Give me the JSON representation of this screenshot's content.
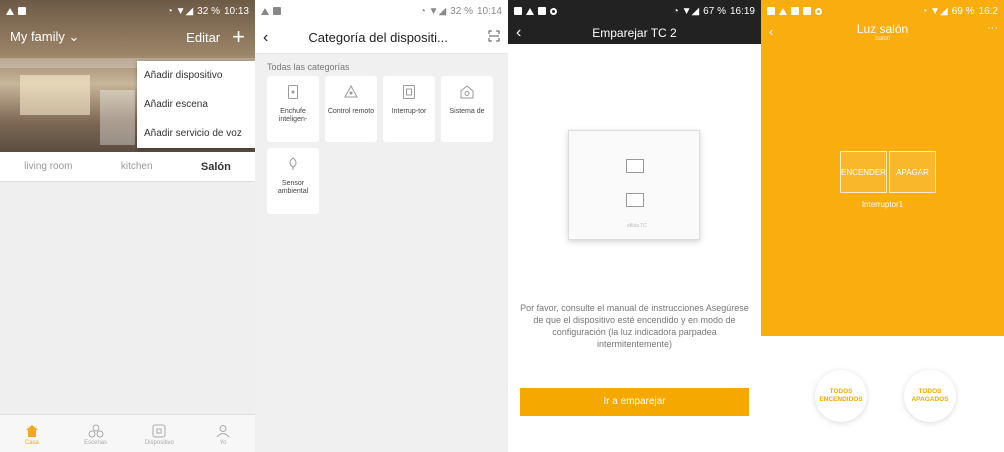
{
  "screen1": {
    "status": {
      "left_icons": [
        "notification-icon",
        "square-icon"
      ],
      "battery": "32 %",
      "time": "10:13"
    },
    "header": {
      "family": "My family",
      "edit": "Editar",
      "add": "+"
    },
    "menu": [
      "Añadir dispositivo",
      "Añadir escena",
      "Añadir servicio de voz"
    ],
    "rooms": [
      "living room",
      "kitchen",
      "Salón"
    ],
    "nav": [
      "Casa",
      "Escenas",
      "Dispositivo",
      "Yo"
    ],
    "accent": "#f5a623"
  },
  "screen2": {
    "status": {
      "battery": "32 %",
      "time": "10:14"
    },
    "title": "Categoría del dispositi...",
    "section": "Todas las categorías",
    "categories": [
      "Enchufe inteligen-",
      "Control remoto",
      "Interrup-tor",
      "Sistema de",
      "Sensor ambiental"
    ]
  },
  "screen3": {
    "status": {
      "battery": "67 %",
      "time": "16:19"
    },
    "title": "Emparejar TC 2",
    "device_brand": "efibia TC",
    "instructions": "Por favor, consulte el manual de instrucciones Asegúrese de que el dispositivo esté encendido y en modo de configuración (la luz indicadora parpadea intermitentemente)",
    "pair_button": "Ir a emparejar",
    "accent": "#f5a800"
  },
  "screen4": {
    "status": {
      "battery": "69 %",
      "time": "16:2"
    },
    "title": "Luz salón",
    "subtitle": "Salón",
    "on_button": "ENCENDER",
    "off_button": "APAGAR",
    "switch_label": "Interruptor1",
    "all_on": "TODOS ENCENDIDOS",
    "all_off": "TODOS APAGADOS",
    "accent": "#f9ad0e"
  }
}
